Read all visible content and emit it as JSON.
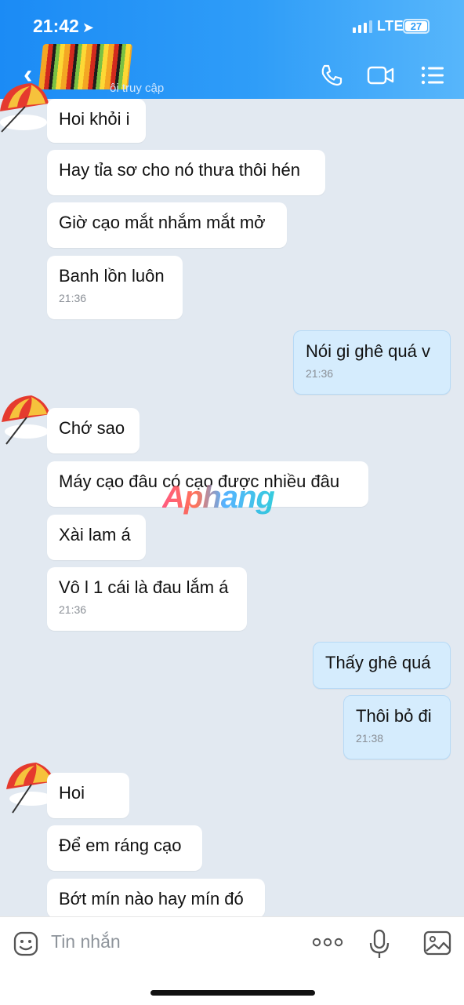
{
  "status_bar": {
    "time": "21:42",
    "network": "LTE",
    "battery": "27"
  },
  "header": {
    "subtitle": "ôi truy cập"
  },
  "messages": [
    {
      "text": "Hoi khỏi i"
    },
    {
      "text": "Hay tỉa sơ cho nó thưa thôi hén"
    },
    {
      "text": "Giờ cạo mắt nhắm mắt mở"
    },
    {
      "text": "Banh lồn luôn",
      "time": "21:36"
    },
    {
      "text": "Nói gi ghê quá v",
      "time": "21:36"
    },
    {
      "text": "Chớ sao"
    },
    {
      "text": "Máy cạo đâu có cạo được nhiều đâu"
    },
    {
      "text": "Xài lam á"
    },
    {
      "text": "Vô l 1 cái là đau lắm á",
      "time": "21:36"
    },
    {
      "text": "Thấy ghê quá"
    },
    {
      "text": "Thôi bỏ đi",
      "time": "21:38"
    },
    {
      "text": "Hoi"
    },
    {
      "text": "Để em ráng cạo"
    },
    {
      "text": "Bớt mín nào hay mín đó"
    }
  ],
  "watermark": "Aphang",
  "input": {
    "placeholder": "Tin nhắn"
  },
  "colors": {
    "header": "#2f9df8",
    "outgoing_bubble": "#d5ecfd",
    "background": "#e2e9f1"
  }
}
